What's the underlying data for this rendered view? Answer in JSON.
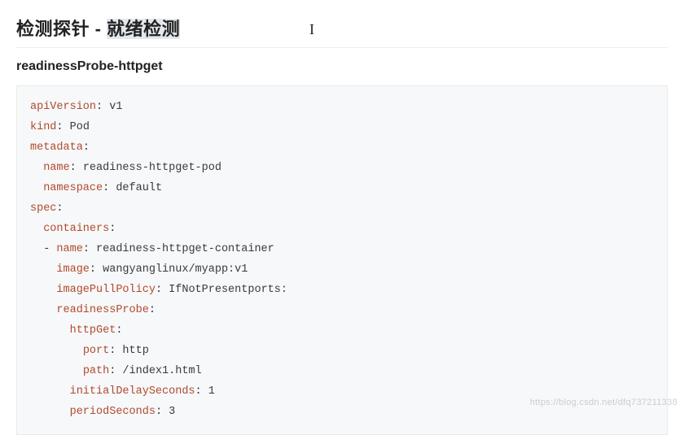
{
  "heading": {
    "prefix": "检测探针 - ",
    "highlight": "就绪检测"
  },
  "subheading": "readinessProbe-httpget",
  "code": {
    "l1": {
      "k": "apiVersion",
      "v": " v1"
    },
    "l2": {
      "k": "kind",
      "v": " Pod"
    },
    "l3": {
      "k": "metadata"
    },
    "l4": {
      "k": "name",
      "v": " readiness-httpget-pod"
    },
    "l5": {
      "k": "namespace",
      "v": " default"
    },
    "l6": {
      "k": "spec"
    },
    "l7": {
      "k": "containers"
    },
    "l8": {
      "k": "name",
      "v": " readiness-httpget-container"
    },
    "l9": {
      "k": "image",
      "v": " wangyanglinux/myapp:v1"
    },
    "l10": {
      "k": "imagePullPolicy",
      "v": " IfNotPresentports:"
    },
    "l11": {
      "k": "readinessProbe"
    },
    "l12": {
      "k": "httpGet"
    },
    "l13": {
      "k": "port",
      "v": " http"
    },
    "l14": {
      "k": "path",
      "v": " /index1.html"
    },
    "l15": {
      "k": "initialDelaySeconds",
      "v": " 1"
    },
    "l16": {
      "k": "periodSeconds",
      "v": " 3"
    }
  },
  "cursor": "I",
  "watermark": "https://blog.csdn.net/dfq737211338"
}
